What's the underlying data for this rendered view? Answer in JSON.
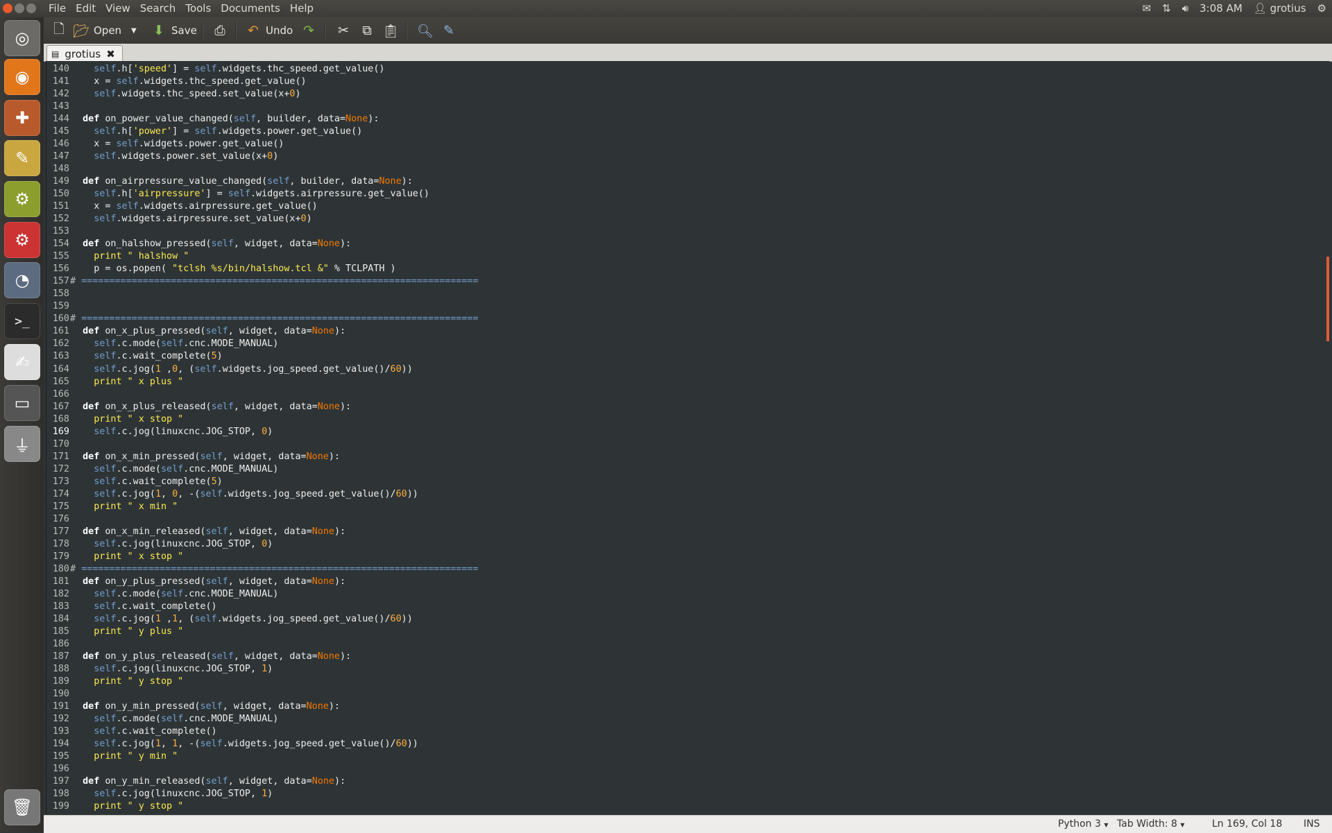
{
  "topbar": {
    "menus": [
      "File",
      "Edit",
      "View",
      "Search",
      "Tools",
      "Documents",
      "Help"
    ],
    "time": "3:08 AM",
    "user": "grotius",
    "icons": [
      "mail-icon",
      "network-icon",
      "volume-icon",
      "user-icon",
      "settings-gear-icon"
    ],
    "window_button_colors": [
      "#e85a2e",
      "#7b7a74",
      "#7b7a74"
    ]
  },
  "launcher": {
    "items": [
      {
        "name": "dash-home-icon",
        "glyph": "◎",
        "color": "#6b6a66"
      },
      {
        "name": "firefox-icon",
        "glyph": "◉",
        "color": "#e2761b"
      },
      {
        "name": "tools-app-icon",
        "glyph": "✚",
        "color": "#b85a2c"
      },
      {
        "name": "drawing-app-icon",
        "glyph": "✎",
        "color": "#c9a640"
      },
      {
        "name": "gears-app-icon",
        "glyph": "⚙",
        "color": "#8c9e2e"
      },
      {
        "name": "software-center-icon",
        "glyph": "⚙",
        "color": "#c33"
      },
      {
        "name": "system-monitor-icon",
        "glyph": "◔",
        "color": "#5c6b80"
      },
      {
        "name": "terminal-icon",
        "glyph": ">_",
        "color": "#2b2b2b"
      },
      {
        "name": "text-editor-icon",
        "glyph": "✍",
        "color": "#ddd"
      },
      {
        "name": "workspace-switcher-icon",
        "glyph": "▭",
        "color": "#555"
      },
      {
        "name": "usb-drive-icon",
        "glyph": "⏚",
        "color": "#888"
      },
      {
        "name": "trash-icon",
        "glyph": "🗑",
        "color": "#777"
      }
    ]
  },
  "toolbar": {
    "open_label": "Open",
    "save_label": "Save",
    "undo_label": "Undo"
  },
  "tab": {
    "title": "grotius"
  },
  "editor": {
    "lines": [
      {
        "n": "",
        "code": ""
      },
      {
        "n": "140",
        "code": "    self.h['speed'] = self.widgets.thc_speed.get_value()"
      },
      {
        "n": "141",
        "code": "    x = self.widgets.thc_speed.get_value()"
      },
      {
        "n": "142",
        "code": "    self.widgets.thc_speed.set_value(x+0)"
      },
      {
        "n": "143",
        "code": ""
      },
      {
        "n": "144",
        "code": "  def on_power_value_changed(self, builder, data=None):"
      },
      {
        "n": "145",
        "code": "    self.h['power'] = self.widgets.power.get_value()"
      },
      {
        "n": "146",
        "code": "    x = self.widgets.power.get_value()"
      },
      {
        "n": "147",
        "code": "    self.widgets.power.set_value(x+0)"
      },
      {
        "n": "148",
        "code": ""
      },
      {
        "n": "149",
        "code": "  def on_airpressure_value_changed(self, builder, data=None):"
      },
      {
        "n": "150",
        "code": "    self.h['airpressure'] = self.widgets.airpressure.get_value()"
      },
      {
        "n": "151",
        "code": "    x = self.widgets.airpressure.get_value()"
      },
      {
        "n": "152",
        "code": "    self.widgets.airpressure.set_value(x+0)"
      },
      {
        "n": "153",
        "code": ""
      },
      {
        "n": "154",
        "code": "  def on_halshow_pressed(self, widget, data=None):"
      },
      {
        "n": "155",
        "code": "    print \" halshow \""
      },
      {
        "n": "156",
        "code": "    p = os.popen( \"tclsh %s/bin/halshow.tcl &\" % TCLPATH )"
      },
      {
        "n": "157",
        "code": "# ======================================================================="
      },
      {
        "n": "158",
        "code": ""
      },
      {
        "n": "159",
        "code": ""
      },
      {
        "n": "160",
        "code": "# ======================================================================="
      },
      {
        "n": "161",
        "code": "  def on_x_plus_pressed(self, widget, data=None):"
      },
      {
        "n": "162",
        "code": "    self.c.mode(self.cnc.MODE_MANUAL)"
      },
      {
        "n": "163",
        "code": "    self.c.wait_complete(5)"
      },
      {
        "n": "164",
        "code": "    self.c.jog(1 ,0, (self.widgets.jog_speed.get_value()/60))"
      },
      {
        "n": "165",
        "code": "    print \" x plus \""
      },
      {
        "n": "166",
        "code": ""
      },
      {
        "n": "167",
        "code": "  def on_x_plus_released(self, widget, data=None):"
      },
      {
        "n": "168",
        "code": "    print \" x stop \""
      },
      {
        "n": "169",
        "code": "    self.c.jog(linuxcnc.JOG_STOP, 0)"
      },
      {
        "n": "170",
        "code": ""
      },
      {
        "n": "171",
        "code": "  def on_x_min_pressed(self, widget, data=None):"
      },
      {
        "n": "172",
        "code": "    self.c.mode(self.cnc.MODE_MANUAL)"
      },
      {
        "n": "173",
        "code": "    self.c.wait_complete(5)"
      },
      {
        "n": "174",
        "code": "    self.c.jog(1, 0, -(self.widgets.jog_speed.get_value()/60))"
      },
      {
        "n": "175",
        "code": "    print \" x min \""
      },
      {
        "n": "176",
        "code": ""
      },
      {
        "n": "177",
        "code": "  def on_x_min_released(self, widget, data=None):"
      },
      {
        "n": "178",
        "code": "    self.c.jog(linuxcnc.JOG_STOP, 0)"
      },
      {
        "n": "179",
        "code": "    print \" x stop \""
      },
      {
        "n": "180",
        "code": "# ======================================================================="
      },
      {
        "n": "181",
        "code": "  def on_y_plus_pressed(self, widget, data=None):"
      },
      {
        "n": "182",
        "code": "    self.c.mode(self.cnc.MODE_MANUAL)"
      },
      {
        "n": "183",
        "code": "    self.c.wait_complete()"
      },
      {
        "n": "184",
        "code": "    self.c.jog(1 ,1, (self.widgets.jog_speed.get_value()/60))"
      },
      {
        "n": "185",
        "code": "    print \" y plus \""
      },
      {
        "n": "186",
        "code": ""
      },
      {
        "n": "187",
        "code": "  def on_y_plus_released(self, widget, data=None):"
      },
      {
        "n": "188",
        "code": "    self.c.jog(linuxcnc.JOG_STOP, 1)"
      },
      {
        "n": "189",
        "code": "    print \" y stop \""
      },
      {
        "n": "190",
        "code": ""
      },
      {
        "n": "191",
        "code": "  def on_y_min_pressed(self, widget, data=None):"
      },
      {
        "n": "192",
        "code": "    self.c.mode(self.cnc.MODE_MANUAL)"
      },
      {
        "n": "193",
        "code": "    self.c.wait_complete()"
      },
      {
        "n": "194",
        "code": "    self.c.jog(1, 1, -(self.widgets.jog_speed.get_value()/60))"
      },
      {
        "n": "195",
        "code": "    print \" y min \""
      },
      {
        "n": "196",
        "code": ""
      },
      {
        "n": "197",
        "code": "  def on_y_min_released(self, widget, data=None):"
      },
      {
        "n": "198",
        "code": "    self.c.jog(linuxcnc.JOG_STOP, 1)"
      },
      {
        "n": "199",
        "code": "    print \" y stop \""
      }
    ]
  },
  "statusbar": {
    "language": "Python 3",
    "tab_width": "Tab Width: 8",
    "position": "Ln 169, Col 18",
    "mode": "INS"
  }
}
